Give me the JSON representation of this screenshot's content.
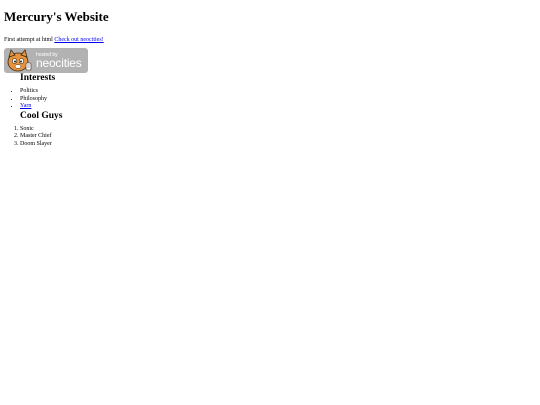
{
  "header": {
    "title": "Mercury's Website"
  },
  "intro": {
    "text": "First attempt at html ",
    "link_label": "Check out neocities!"
  },
  "badge": {
    "hosted_label": "hosted by",
    "brand_label": "neocities",
    "icon": "neocities-cat-icon"
  },
  "interests": {
    "heading": "Interests",
    "items": [
      "Politics",
      "Philosophy",
      "Yarn"
    ]
  },
  "cool_guys": {
    "heading": "Cool Guys",
    "items": [
      "Sonic",
      "Master Chief",
      "Doom Slayer"
    ]
  },
  "colors": {
    "link": "#0000ee",
    "badge_background": "#b2b2b2",
    "badge_text": "#ffffff",
    "cat_orange": "#e8933b"
  }
}
